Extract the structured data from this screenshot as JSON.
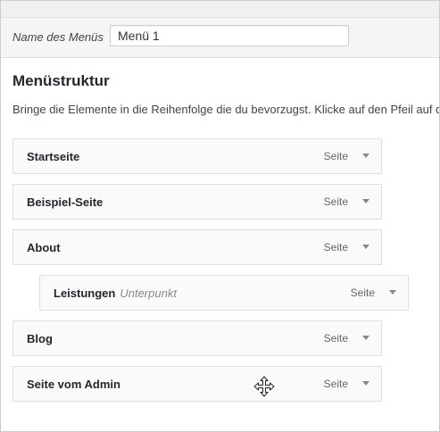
{
  "header": {
    "menu_name_label": "Name des Menüs",
    "menu_name_value": "Menü 1"
  },
  "structure": {
    "title": "Menüstruktur",
    "description": "Bringe die Elemente in die Reihenfolge die du bevorzugst. Klicke auf den Pfeil auf d"
  },
  "items": [
    {
      "title": "Startseite",
      "subtitle": "",
      "type": "Seite"
    },
    {
      "title": "Beispiel-Seite",
      "subtitle": "",
      "type": "Seite"
    },
    {
      "title": "About",
      "subtitle": "",
      "type": "Seite"
    },
    {
      "title": "Leistungen",
      "subtitle": "Unterpunkt",
      "type": "Seite"
    },
    {
      "title": "Blog",
      "subtitle": "",
      "type": "Seite"
    },
    {
      "title": "Seite vom Admin",
      "subtitle": "",
      "type": "Seite"
    }
  ],
  "icons": {
    "toggle": "arrow-down-icon",
    "cursor": "move-cursor-icon"
  }
}
